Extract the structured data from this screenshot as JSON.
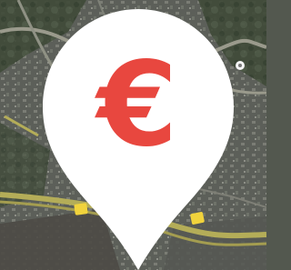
{
  "marker": {
    "symbol": "€",
    "symbol_color": "#e8473f",
    "pin_color": "#ffffff"
  },
  "map": {
    "base_color": "#53584f",
    "road_color": "#9a9a8c",
    "highway_color": "#b4ad58",
    "label_color": "#dfe4d7",
    "road_shield_color": "#f1d33c",
    "point_icon_color": "#f4f4f4"
  }
}
